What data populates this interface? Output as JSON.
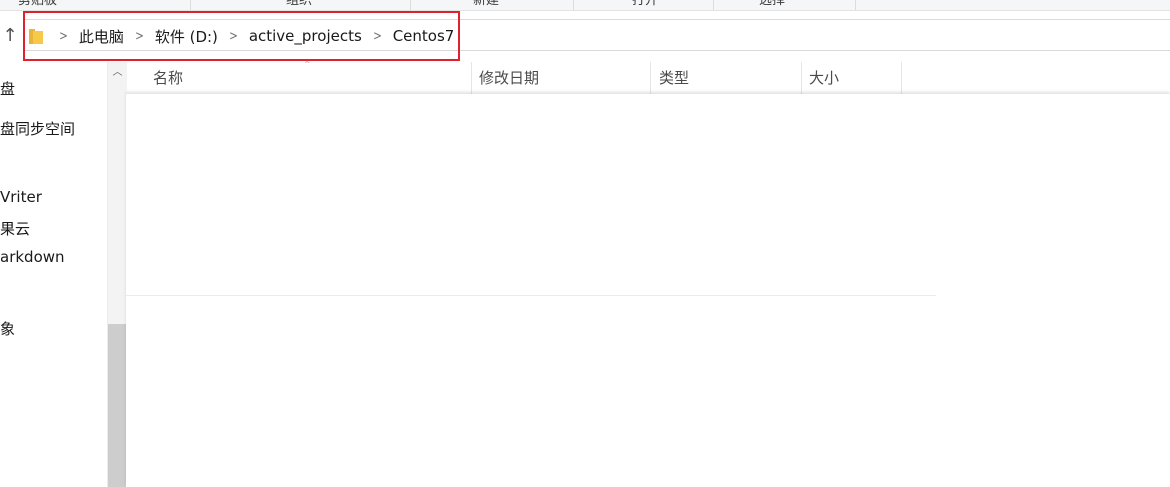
{
  "ribbon": {
    "groups": [
      "剪贴板",
      "组织",
      "新建",
      "打开",
      "选择"
    ]
  },
  "address": {
    "crumbs": [
      "此电脑",
      "软件 (D:)",
      "active_projects",
      "Centos7"
    ]
  },
  "sidebar": {
    "items": [
      "盘",
      "盘同步空间",
      "Vriter",
      "果云",
      "arkdown",
      "象"
    ]
  },
  "columns": {
    "name": "名称",
    "modified": "修改日期",
    "type": "类型",
    "size": "大小"
  },
  "icons": {
    "up": "up-arrow-icon",
    "folder": "folder-icon",
    "separator": "chevron-right-icon",
    "scroll_up": "chevron-up-icon"
  },
  "colors": {
    "highlight": "#e0202a",
    "folder": "#f7c94b"
  }
}
